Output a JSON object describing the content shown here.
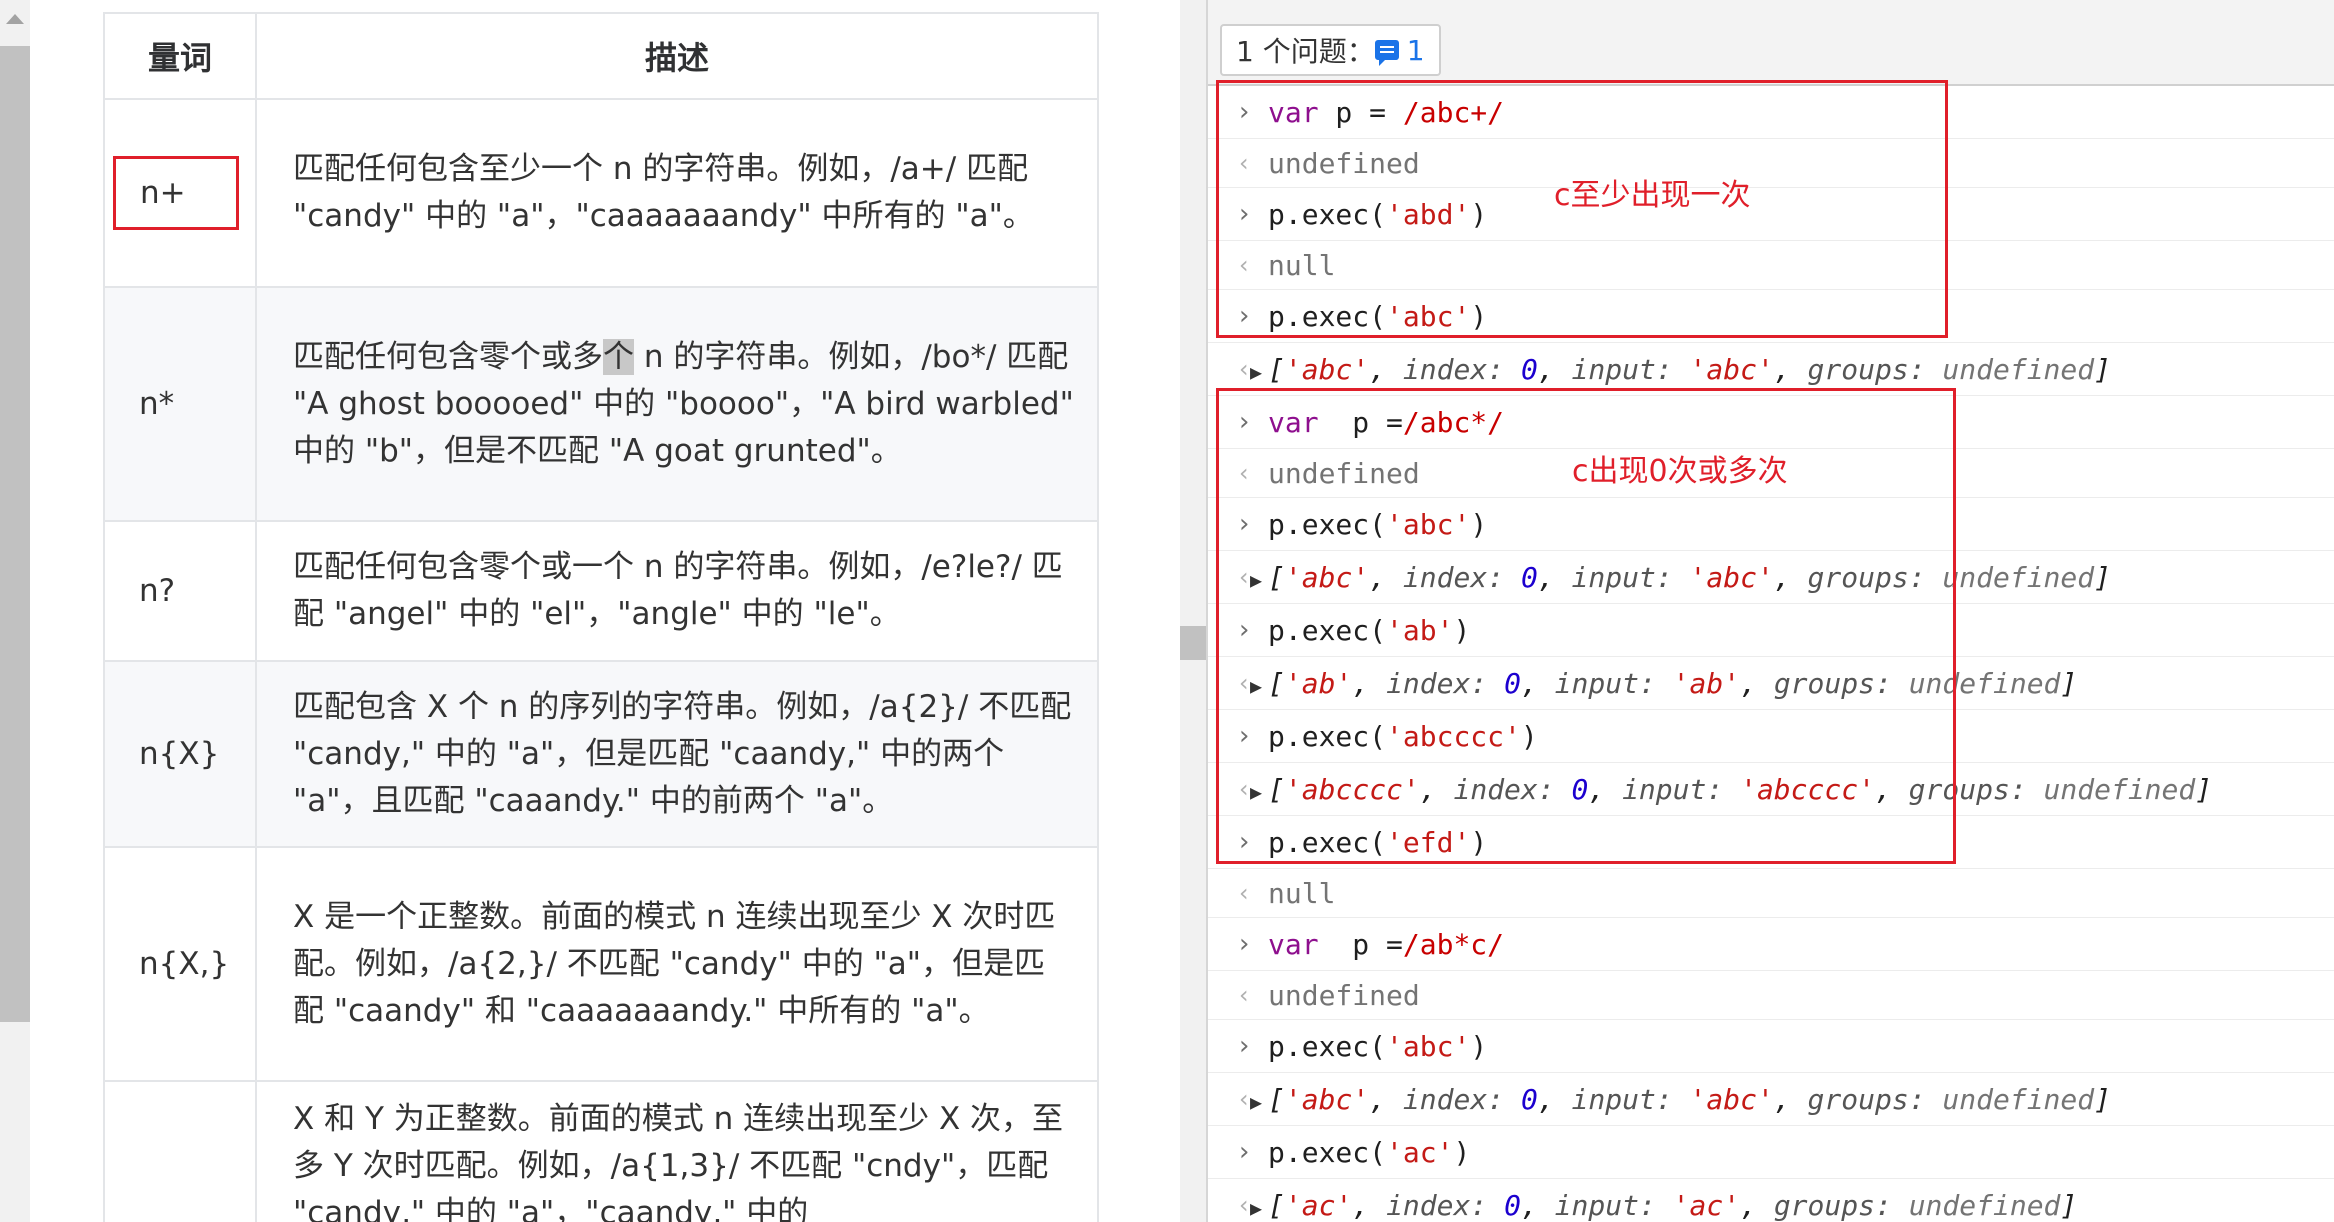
{
  "doc_table": {
    "headers": [
      "量词",
      "描述"
    ],
    "rows": [
      {
        "quantifier": "n+",
        "description": "匹配任何包含至少一个 n 的字符串。例如，/a+/ 匹配 \"candy\" 中的 \"a\"，\"caaaaaaandy\" 中所有的 \"a\"。"
      },
      {
        "quantifier": "n*",
        "description_pre": "匹配任何包含零个或多",
        "description_hl": "个",
        "description_post": " n 的字符串。例如，/bo*/ 匹配 \"A ghost booooed\" 中的 \"boooo\"，\"A bird warbled\" 中的 \"b\"，但是不匹配 \"A goat grunted\"。"
      },
      {
        "quantifier": "n?",
        "description": "匹配任何包含零个或一个 n 的字符串。例如，/e?le?/ 匹配 \"angel\" 中的 \"el\"，\"angle\" 中的 \"le\"。"
      },
      {
        "quantifier": "n{X}",
        "description": "匹配包含 X 个 n 的序列的字符串。例如，/a{2}/ 不匹配 \"candy,\" 中的 \"a\"，但是匹配 \"caandy,\" 中的两个 \"a\"，且匹配 \"caaandy.\" 中的前两个 \"a\"。"
      },
      {
        "quantifier": "n{X,}",
        "description": "X 是一个正整数。前面的模式 n 连续出现至少 X 次时匹配。例如，/a{2,}/ 不匹配 \"candy\" 中的 \"a\"，但是匹配 \"caandy\" 和 \"caaaaaaandy.\" 中所有的 \"a\"。"
      },
      {
        "quantifier": "",
        "description": "X 和 Y 为正整数。前面的模式 n 连续出现至少 X 次，至多 Y 次时匹配。例如，/a{1,3}/ 不匹配 \"cndy\"，匹配 \"candy,\" 中的 \"a\"，\"caandy,\" 中的"
      }
    ]
  },
  "console": {
    "issues_label": "1 个问题：",
    "issues_count": "1",
    "annotations": [
      "c至少出现一次",
      "c出现0次或多次"
    ],
    "entries": [
      {
        "kind": "in",
        "kw": "var",
        "rest": " p = ",
        "re": "/abc+/"
      },
      {
        "kind": "undef",
        "text": "undefined"
      },
      {
        "kind": "call",
        "pre": "p.exec(",
        "arg": "'abd'",
        "post": ")"
      },
      {
        "kind": "undef",
        "text": "null"
      },
      {
        "kind": "call",
        "pre": "p.exec(",
        "arg": "'abc'",
        "post": ")"
      },
      {
        "kind": "obj",
        "match": "'abc'",
        "index": "0",
        "input": "'abc'",
        "groups": "undefined"
      },
      {
        "kind": "in",
        "kw": "var",
        "rest": "  p =",
        "re": "/abc*/"
      },
      {
        "kind": "undef",
        "text": "undefined"
      },
      {
        "kind": "call",
        "pre": "p.exec(",
        "arg": "'abc'",
        "post": ")"
      },
      {
        "kind": "obj",
        "match": "'abc'",
        "index": "0",
        "input": "'abc'",
        "groups": "undefined"
      },
      {
        "kind": "call",
        "pre": "p.exec(",
        "arg": "'ab'",
        "post": ")"
      },
      {
        "kind": "obj",
        "match": "'ab'",
        "index": "0",
        "input": "'ab'",
        "groups": "undefined"
      },
      {
        "kind": "call",
        "pre": "p.exec(",
        "arg": "'abcccc'",
        "post": ")"
      },
      {
        "kind": "obj",
        "match": "'abcccc'",
        "index": "0",
        "input": "'abcccc'",
        "groups": "undefined"
      },
      {
        "kind": "call",
        "pre": "p.exec(",
        "arg": "'efd'",
        "post": ")"
      },
      {
        "kind": "undef",
        "text": "null"
      },
      {
        "kind": "in",
        "kw": "var",
        "rest": "  p =",
        "re": "/ab*c/"
      },
      {
        "kind": "undef",
        "text": "undefined"
      },
      {
        "kind": "call",
        "pre": "p.exec(",
        "arg": "'abc'",
        "post": ")"
      },
      {
        "kind": "obj",
        "match": "'abc'",
        "index": "0",
        "input": "'abc'",
        "groups": "undefined"
      },
      {
        "kind": "call",
        "pre": "p.exec(",
        "arg": "'ac'",
        "post": ")"
      },
      {
        "kind": "obj",
        "match": "'ac'",
        "index": "0",
        "input": "'ac'",
        "groups": "undefined"
      }
    ]
  }
}
